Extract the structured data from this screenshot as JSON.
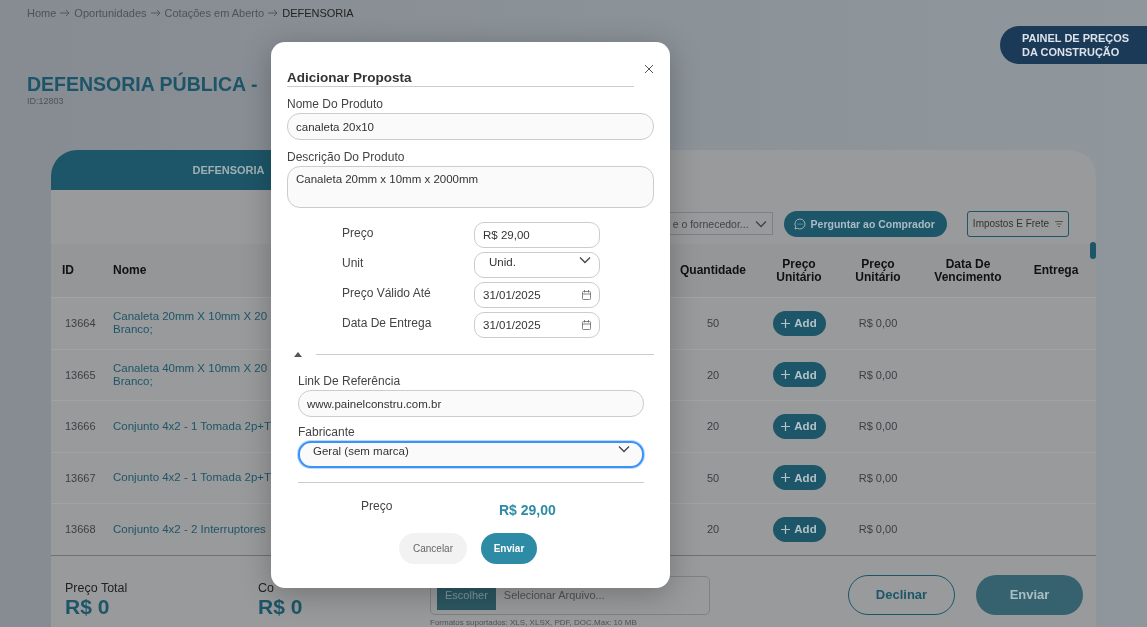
{
  "breadcrumb": [
    {
      "label": "Home",
      "current": false
    },
    {
      "label": "Oportunidades",
      "current": false
    },
    {
      "label": "Cotações em Aberto",
      "current": false
    },
    {
      "label": "DEFENSORIA",
      "current": true
    }
  ],
  "logo": {
    "lines": [
      "PAINEL DE PREÇOS",
      "DA CONSTRUÇÃO"
    ]
  },
  "page_title": "DEFENSORIA PÚBLICA -",
  "page_id": "ID:12803",
  "tab": {
    "label": "DEFENSORIA"
  },
  "toolbar": {
    "supplier_select": "e o fornecedor...",
    "ask_button": "Perguntar ao Comprador",
    "filter_select": "Impostos E Frete"
  },
  "table": {
    "columns": [
      "ID",
      "Nome",
      "Quantidade",
      "Preço Unitário",
      "Preço Unitário",
      "Data De Vencimento",
      "Entrega"
    ],
    "rows": [
      {
        "id": "13664",
        "name": "Canaleta 20mm X 10mm X 20\nBranco;",
        "quantity": "50",
        "add_button": "Add",
        "unit_price": "R$ 0,00"
      },
      {
        "id": "13665",
        "name": "Canaleta 40mm X 10mm X 20\nBranco;",
        "quantity": "20",
        "add_button": "Add",
        "unit_price": "R$ 0,00"
      },
      {
        "id": "13666",
        "name": "Conjunto 4x2 - 1 Tomada 2p+T",
        "quantity": "20",
        "add_button": "Add",
        "unit_price": "R$ 0,00"
      },
      {
        "id": "13667",
        "name": "Conjunto 4x2 - 1 Tomada 2p+T",
        "quantity": "50",
        "add_button": "Add",
        "unit_price": "R$ 0,00"
      },
      {
        "id": "13668",
        "name": "Conjunto 4x2 - 2 Interruptores",
        "quantity": "20",
        "add_button": "Add",
        "unit_price": "R$ 0,00"
      }
    ]
  },
  "footer": {
    "totals": [
      {
        "label": "Preço Total",
        "value": "R$ 0"
      },
      {
        "label": "Co",
        "value": "R$ 0"
      }
    ],
    "file": {
      "button": "Escolher",
      "placeholder": "Selecionar Arquivo...",
      "hint": "Formatos suportados: XLS, XLSX, PDF, DOC.Max: 10 MB"
    },
    "decline_button": "Declinar",
    "send_button": "Enviar"
  },
  "modal": {
    "title": "Adicionar Proposta",
    "product_name": {
      "label": "Nome Do Produto",
      "value": "canaleta 20x10"
    },
    "description": {
      "label": "Descrição Do Produto",
      "value": "Canaleta 20mm x 10mm x 2000mm"
    },
    "rows": [
      {
        "kind": "text",
        "label": "Preço",
        "value": "R$ 29,00"
      },
      {
        "kind": "select",
        "label": "Unit",
        "value": "Unid."
      },
      {
        "kind": "date",
        "label": "Preço Válido Até",
        "value": "31/01/2025"
      },
      {
        "kind": "date",
        "label": "Data De Entrega",
        "value": "31/01/2025"
      }
    ],
    "more": {
      "expanded": true
    },
    "reference_link": {
      "label": "Link De Referência",
      "value": "www.painelconstru.com.br"
    },
    "manufacturer": {
      "label": "Fabricante",
      "value": "Geral (sem marca)",
      "focused": true
    },
    "total": {
      "label": "Preço",
      "value": "R$ 29,00"
    },
    "cancel_button": "Cancelar",
    "submit_button": "Enviar"
  }
}
